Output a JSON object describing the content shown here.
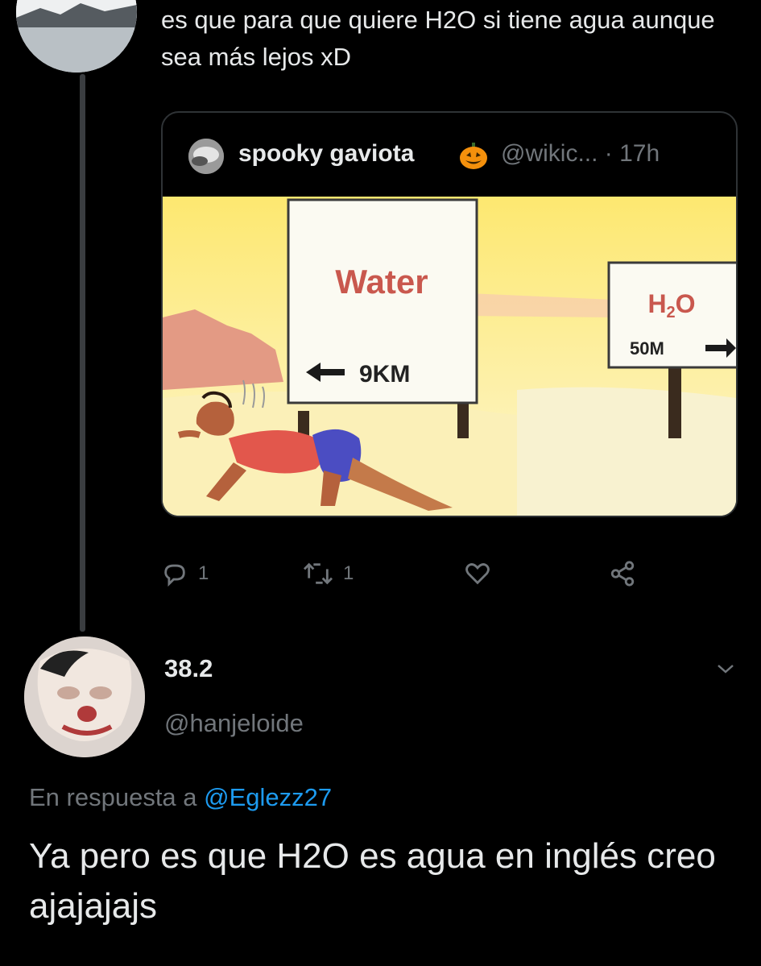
{
  "top_tweet": {
    "text": "es que para que quiere H2O si tiene agua aunque sea más lejos xD"
  },
  "quoted_tweet": {
    "author_name": "spooky gaviota",
    "author_emoji": "jack-o-lantern-icon",
    "handle_time": "@wikic... · 17h",
    "image": {
      "sign_left_title": "Water",
      "sign_left_distance": "9KM",
      "sign_right_title_main": "H",
      "sign_right_title_sub": "2",
      "sign_right_title_end": "O",
      "sign_right_distance": "50M"
    }
  },
  "actions": {
    "reply_count": "1",
    "retweet_count": "1",
    "icons": [
      "reply-icon",
      "retweet-icon",
      "like-icon",
      "share-icon"
    ]
  },
  "reply": {
    "name": "38.2",
    "handle": "@hanjeloide",
    "replying_prefix": "En respuesta a",
    "replying_to": "@Eglezz27",
    "text": "Ya pero es que H2O es agua en inglés creo ajajajajs"
  },
  "colors": {
    "background": "#000000",
    "text": "#e7e9ea",
    "muted": "#71767b",
    "mention": "#1d9bf0",
    "border": "#2f3336"
  }
}
